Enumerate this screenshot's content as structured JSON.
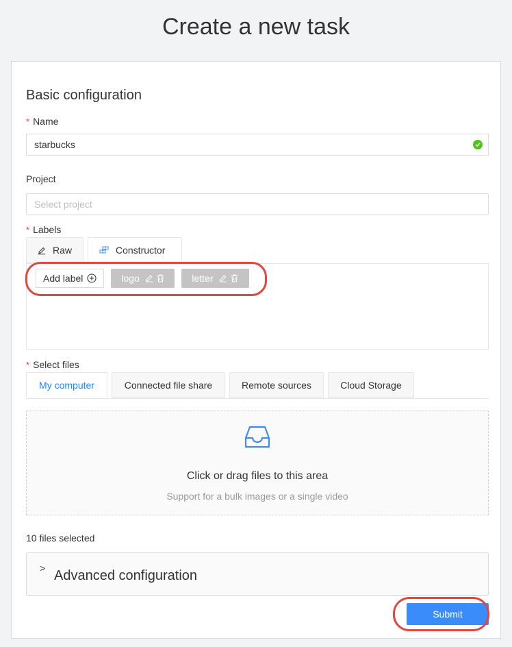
{
  "page": {
    "title": "Create a new task"
  },
  "form": {
    "section_title": "Basic configuration",
    "name": {
      "label": "Name",
      "required_mark": "*",
      "value": "starbucks",
      "status_icon": "check-circle-icon"
    },
    "project": {
      "label": "Project",
      "placeholder": "Select project"
    },
    "labels": {
      "label": "Labels",
      "required_mark": "*",
      "tabs": [
        {
          "label": "Raw",
          "icon": "pencil-icon"
        },
        {
          "label": "Constructor",
          "icon": "blocks-icon",
          "active": true
        }
      ],
      "add_label": "Add label",
      "items": [
        {
          "name": "logo"
        },
        {
          "name": "letter"
        }
      ]
    },
    "select_files": {
      "label": "Select files",
      "required_mark": "*",
      "tabs": [
        {
          "label": "My computer",
          "active": true
        },
        {
          "label": "Connected file share"
        },
        {
          "label": "Remote sources"
        },
        {
          "label": "Cloud Storage"
        }
      ],
      "dropzone": {
        "icon": "inbox-icon",
        "title": "Click or drag files to this area",
        "hint": "Support for a bulk images or a single video"
      },
      "files_count": "10 files selected"
    },
    "advanced": {
      "chevron": ">",
      "title": "Advanced configuration"
    },
    "submit_label": "Submit"
  },
  "colors": {
    "accent": "#1f83ff",
    "submit": "#3b8cfb",
    "success": "#52c41a",
    "required": "#e0473f",
    "annotation": "#e0473f",
    "chip": "#c4c4c4"
  }
}
